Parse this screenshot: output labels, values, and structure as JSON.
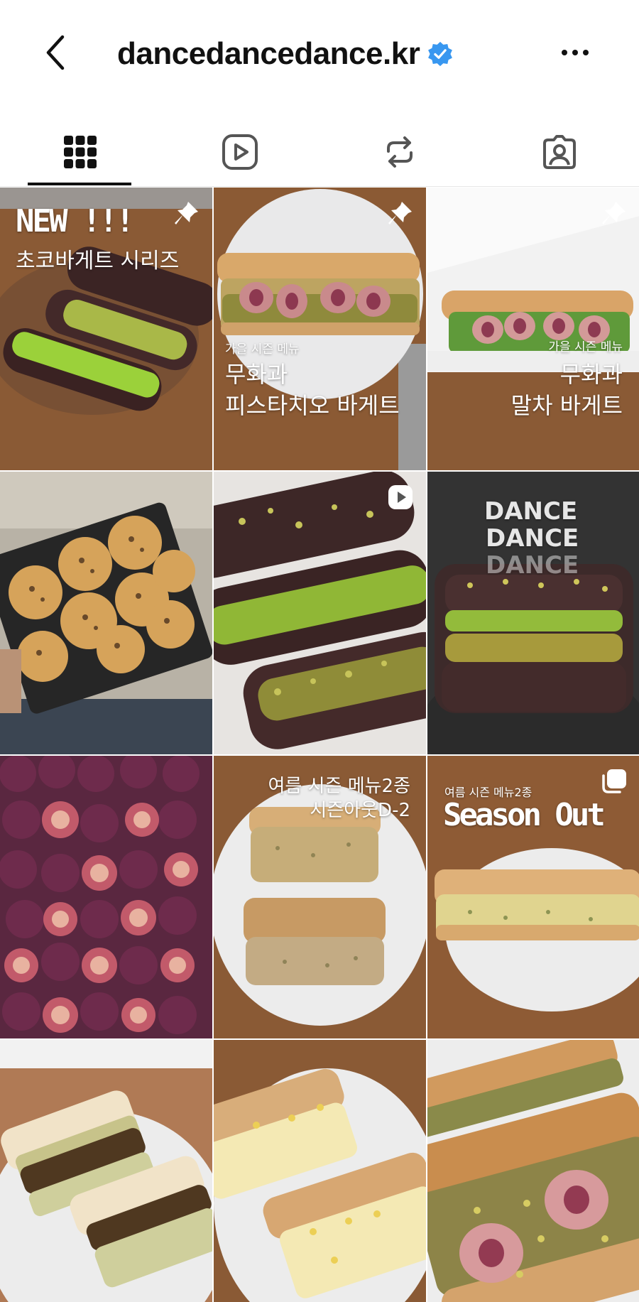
{
  "header": {
    "username": "dancedancedance.kr",
    "back_icon": "chevron-left-icon",
    "verified_icon": "verified-badge-icon",
    "more_icon": "more-horizontal-icon"
  },
  "tabs": [
    {
      "id": "posts",
      "icon": "grid-icon",
      "active": true
    },
    {
      "id": "reels",
      "icon": "reels-icon",
      "active": false
    },
    {
      "id": "reposts",
      "icon": "repost-icon",
      "active": false
    },
    {
      "id": "tagged",
      "icon": "tagged-icon",
      "active": false
    }
  ],
  "colors": {
    "verified": "#3897f0",
    "wood": "#8a5a35",
    "pistachio": "#9cbf3e",
    "chocolate": "#4a2c2c",
    "fig": "#6b2a48"
  },
  "posts": [
    {
      "id": 1,
      "pinned": true,
      "lines": [
        "NEW !!!",
        "초코바게트 시리즈"
      ]
    },
    {
      "id": 2,
      "pinned": true,
      "lines": [
        "가을 시즌 메뉴",
        "무화과",
        "피스타치오 바게트"
      ]
    },
    {
      "id": 3,
      "pinned": true,
      "lines": [
        "가을 시즌 메뉴",
        "무화과",
        "말차 바게트"
      ]
    },
    {
      "id": 4,
      "lines": []
    },
    {
      "id": 5,
      "type": "reel",
      "lines": []
    },
    {
      "id": 6,
      "lines": [],
      "apron_text": [
        "DANCE",
        "DANCE",
        "DANCE"
      ]
    },
    {
      "id": 7,
      "lines": []
    },
    {
      "id": 8,
      "lines": [
        "여름 시즌 메뉴2종",
        "시즌아웃D-2"
      ]
    },
    {
      "id": 9,
      "type": "carousel",
      "lines": [
        "여름 시즌 메뉴2종",
        "Season Out"
      ]
    },
    {
      "id": 10,
      "lines": []
    },
    {
      "id": 11,
      "lines": []
    },
    {
      "id": 12,
      "lines": []
    }
  ]
}
